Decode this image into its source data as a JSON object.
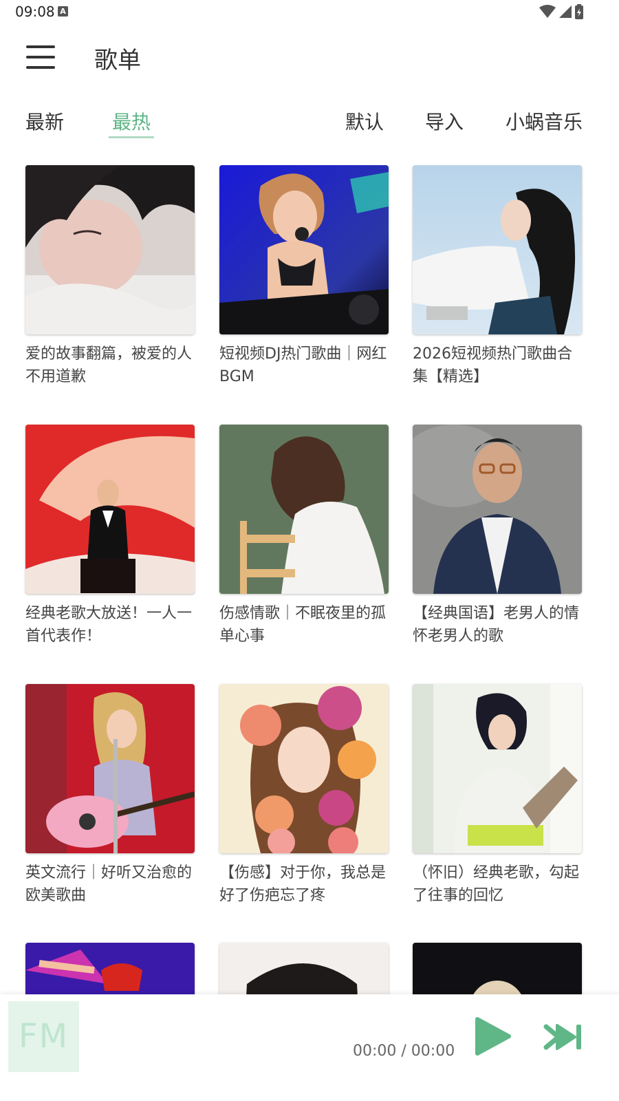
{
  "status_bar": {
    "time": "09:08",
    "badge": "A"
  },
  "header": {
    "title": "歌单",
    "menu_icon": "menu-icon"
  },
  "tabs": [
    {
      "label": "最新",
      "active": false
    },
    {
      "label": "最热",
      "active": true
    },
    {
      "label": "默认",
      "active": false
    },
    {
      "label": "导入",
      "active": false
    },
    {
      "label": "小蜗音乐",
      "active": false
    }
  ],
  "playlists": [
    {
      "title": "爱的故事翻篇，被爱的人不用道歉"
    },
    {
      "title": "短视频DJ热门歌曲｜网红BGM"
    },
    {
      "title": "2026短视频热门歌曲合集【精选】"
    },
    {
      "title": "经典老歌大放送！一人一首代表作！"
    },
    {
      "title": "伤感情歌｜不眠夜里的孤单心事"
    },
    {
      "title": "【经典国语】老男人的情怀老男人的歌"
    },
    {
      "title": "英文流行｜好听又治愈的欧美歌曲"
    },
    {
      "title": "【伤感】对于你，我总是好了伤疤忘了疼"
    },
    {
      "title": "（怀旧）经典老歌，勾起了往事的回忆"
    },
    {
      "title": ""
    },
    {
      "title": ""
    },
    {
      "title": ""
    }
  ],
  "player": {
    "fm_label": "FM",
    "time": "00:00 / 00:00",
    "accent_color": "#5fb687"
  }
}
